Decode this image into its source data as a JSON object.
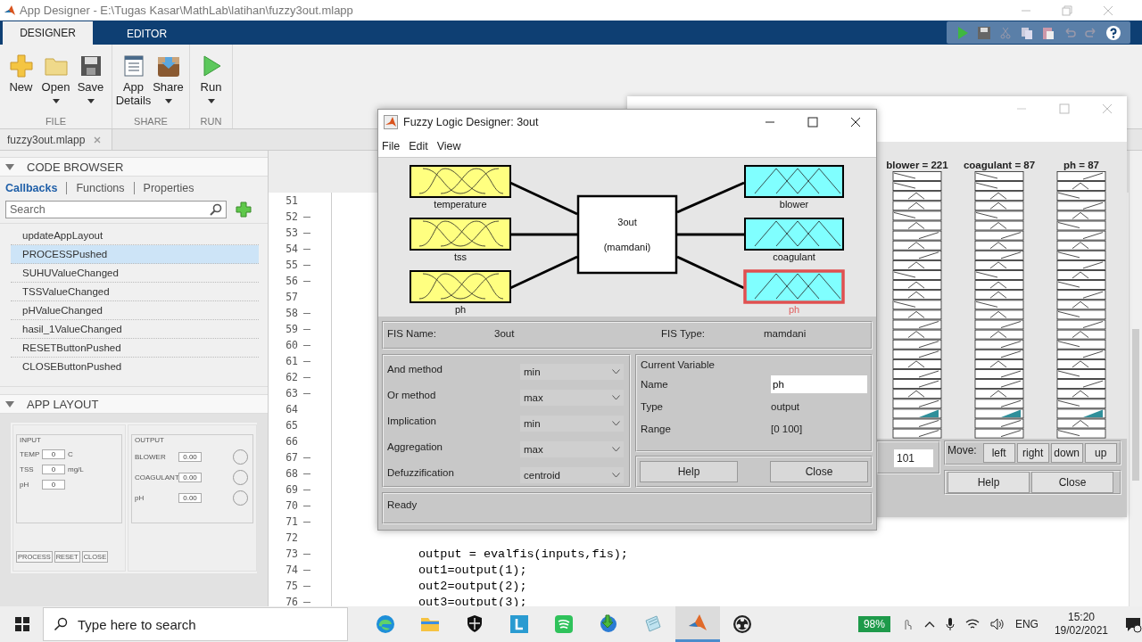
{
  "window": {
    "title": "App Designer - E:\\Tugas Kasar\\MathLab\\latihan\\fuzzy3out.mlapp"
  },
  "ribbon_tabs": [
    {
      "label": "DESIGNER",
      "selected": true
    },
    {
      "label": "EDITOR",
      "selected": false
    }
  ],
  "toolstrip": [
    {
      "group": "FILE",
      "buttons": [
        {
          "label": "New",
          "kind": "new",
          "dropdown": false
        },
        {
          "label": "Open",
          "kind": "open",
          "dropdown": true
        },
        {
          "label": "Save",
          "kind": "save",
          "dropdown": true
        }
      ]
    },
    {
      "group": "SHARE",
      "buttons": [
        {
          "label": "App Details",
          "kind": "details",
          "dropdown": false
        },
        {
          "label": "Share",
          "kind": "share",
          "dropdown": true
        }
      ]
    },
    {
      "group": "RUN",
      "buttons": [
        {
          "label": "Run",
          "kind": "run",
          "dropdown": true
        }
      ]
    }
  ],
  "document_tab": {
    "label": "fuzzy3out.mlapp"
  },
  "code_browser": {
    "title": "CODE BROWSER",
    "tabs": [
      {
        "label": "Callbacks",
        "selected": true
      },
      {
        "label": "Functions",
        "selected": false
      },
      {
        "label": "Properties",
        "selected": false
      }
    ],
    "search": {
      "placeholder": "Search"
    },
    "callbacks": [
      {
        "name": "updateAppLayout",
        "selected": false
      },
      {
        "name": "PROCESSPushed",
        "selected": true
      },
      {
        "name": "SUHUValueChanged",
        "selected": false
      },
      {
        "name": "TSSValueChanged",
        "selected": false
      },
      {
        "name": "pHValueChanged",
        "selected": false
      },
      {
        "name": "hasil_1ValueChanged",
        "selected": false
      },
      {
        "name": "RESETButtonPushed",
        "selected": false
      },
      {
        "name": "CLOSEButtonPushed",
        "selected": false
      }
    ]
  },
  "app_layout": {
    "title": "APP LAYOUT",
    "input_panel": {
      "title": "INPUT",
      "fields": [
        {
          "label": "TEMP",
          "value": "0",
          "unit": "C"
        },
        {
          "label": "TSS",
          "value": "0",
          "unit": "mg/L"
        },
        {
          "label": "pH",
          "value": "0"
        }
      ]
    },
    "output_panel": {
      "title": "OUTPUT",
      "fields": [
        {
          "label": "BLOWER",
          "value": "0.00"
        },
        {
          "label": "COAGULANT",
          "value": "0.00"
        },
        {
          "label": "pH",
          "value": "0.00"
        }
      ]
    },
    "buttons": [
      "PROCESS",
      "RESET",
      "CLOSE"
    ]
  },
  "editor": {
    "lines": [
      {
        "number": "51",
        "executable": false
      },
      {
        "number": "52",
        "executable": true
      },
      {
        "number": "53",
        "executable": true
      },
      {
        "number": "54",
        "executable": true
      },
      {
        "number": "55",
        "executable": true
      },
      {
        "number": "56",
        "executable": true
      },
      {
        "number": "57",
        "executable": false
      },
      {
        "number": "58",
        "executable": true
      },
      {
        "number": "59",
        "executable": true
      },
      {
        "number": "60",
        "executable": true
      },
      {
        "number": "61",
        "executable": true
      },
      {
        "number": "62",
        "executable": true
      },
      {
        "number": "63",
        "executable": true
      },
      {
        "number": "64",
        "executable": false
      },
      {
        "number": "65",
        "executable": false
      },
      {
        "number": "66",
        "executable": false
      },
      {
        "number": "67",
        "executable": true
      },
      {
        "number": "68",
        "executable": true
      },
      {
        "number": "69",
        "executable": true
      },
      {
        "number": "70",
        "executable": true
      },
      {
        "number": "71",
        "executable": true
      },
      {
        "number": "72",
        "executable": false
      },
      {
        "number": "73",
        "executable": true,
        "code": "output = evalfis(inputs,fis);"
      },
      {
        "number": "74",
        "executable": true,
        "code": "out1=output(1);"
      },
      {
        "number": "75",
        "executable": true,
        "code": "out2=output(2);"
      },
      {
        "number": "76",
        "executable": true,
        "code": "out3=output(3);"
      }
    ]
  },
  "fuzzy_designer": {
    "title": "Fuzzy Logic Designer: 3out",
    "menu": [
      "File",
      "Edit",
      "View"
    ],
    "inputs": [
      {
        "name": "temperature"
      },
      {
        "name": "tss"
      },
      {
        "name": "ph"
      }
    ],
    "system": {
      "name": "3out",
      "type": "(mamdani)"
    },
    "outputs": [
      {
        "name": "blower",
        "selected": false
      },
      {
        "name": "coagulant",
        "selected": false
      },
      {
        "name": "ph",
        "selected": true
      }
    ],
    "fis_name_label": "FIS Name:",
    "fis_name": "3out",
    "fis_type_label": "FIS Type:",
    "fis_type": "mamdani",
    "methods": [
      {
        "label": "And method",
        "value": "min"
      },
      {
        "label": "Or method",
        "value": "max"
      },
      {
        "label": "Implication",
        "value": "min"
      },
      {
        "label": "Aggregation",
        "value": "max"
      },
      {
        "label": "Defuzzification",
        "value": "centroid"
      }
    ],
    "current_variable": {
      "title": "Current Variable",
      "fields": [
        {
          "label": "Name",
          "value": "ph",
          "kind": "input"
        },
        {
          "label": "Type",
          "value": "output",
          "kind": "text"
        },
        {
          "label": "Range",
          "value": "[0 100]",
          "kind": "text"
        }
      ]
    },
    "buttons": [
      "Help",
      "Close"
    ],
    "status": "Ready"
  },
  "rule_viewer": {
    "columns": [
      {
        "heading": "blower = 221"
      },
      {
        "heading": "coagulant = 87"
      },
      {
        "heading": "ph = 87"
      }
    ],
    "rule_field": {
      "value": "101"
    },
    "move_label": "Move:",
    "move_buttons": [
      "left",
      "right",
      "down",
      "up"
    ],
    "buttons": [
      "Help",
      "Close"
    ]
  },
  "taskbar": {
    "search": {
      "placeholder": "Type here to search"
    },
    "apps": [
      {
        "kind": "edge",
        "active": false
      },
      {
        "kind": "folder",
        "active": false
      },
      {
        "kind": "shield",
        "active": false
      },
      {
        "kind": "tile",
        "active": false
      },
      {
        "kind": "music",
        "active": false
      },
      {
        "kind": "globe",
        "active": false
      },
      {
        "kind": "notes",
        "active": false
      },
      {
        "kind": "matlab",
        "active": true
      },
      {
        "kind": "record",
        "active": false
      }
    ],
    "battery": "98%",
    "language": "ENG",
    "time": "15:20",
    "date": "19/02/2021"
  }
}
